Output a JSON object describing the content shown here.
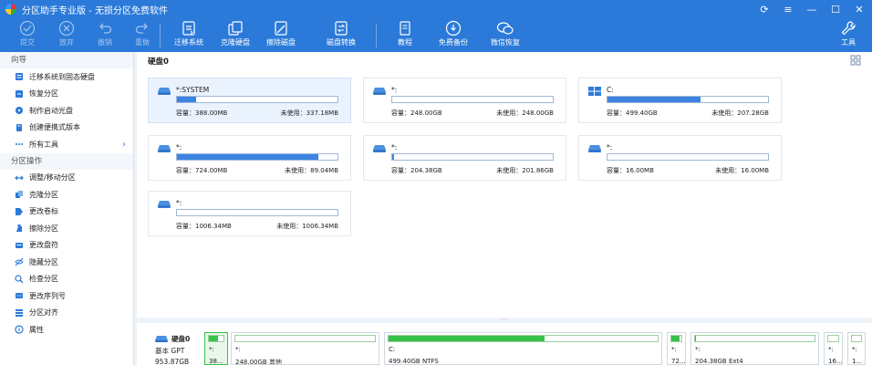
{
  "app": {
    "title": "分区助手专业版 - 无损分区免费软件"
  },
  "toolbar": {
    "commit": "提交",
    "discard": "放弃",
    "undo": "撤销",
    "redo": "重做",
    "migrate": "迁移系统",
    "clone_disk": "克隆硬盘",
    "wipe_disk": "擦除磁盘",
    "disk_convert": "磁盘转换",
    "tutorial": "教程",
    "free_backup": "免费备份",
    "wechat_restore": "微信恢复",
    "tools": "工具"
  },
  "sidebar": {
    "section_wizard": "向导",
    "wizard_items": [
      {
        "label": "迁移系统到固态硬盘",
        "icon": "migrate-icon"
      },
      {
        "label": "恢复分区",
        "icon": "restore-icon"
      },
      {
        "label": "制作启动光盘",
        "icon": "boot-disc-icon"
      },
      {
        "label": "创建便携式版本",
        "icon": "portable-icon"
      },
      {
        "label": "所有工具",
        "icon": "more-icon"
      }
    ],
    "section_ops": "分区操作",
    "ops_items": [
      {
        "label": "调整/移动分区",
        "icon": "resize-icon"
      },
      {
        "label": "克隆分区",
        "icon": "clone-icon"
      },
      {
        "label": "更改卷标",
        "icon": "label-icon"
      },
      {
        "label": "擦除分区",
        "icon": "wipe-icon"
      },
      {
        "label": "更改盘符",
        "icon": "drive-letter-icon"
      },
      {
        "label": "隐藏分区",
        "icon": "hide-icon"
      },
      {
        "label": "检查分区",
        "icon": "check-icon"
      },
      {
        "label": "更改序列号",
        "icon": "serial-icon"
      },
      {
        "label": "分区对齐",
        "icon": "align-icon"
      },
      {
        "label": "属性",
        "icon": "info-icon"
      }
    ]
  },
  "main": {
    "disk_title": "硬盘0",
    "cap_prefix": "容量：",
    "free_prefix": "未使用：",
    "cards": [
      {
        "name": "*:SYSTEM",
        "cap": "388.00MB",
        "free": "337.18MB",
        "fill_pct": 12,
        "os": false,
        "selected": true
      },
      {
        "name": "*:",
        "cap": "248.00GB",
        "free": "248.00GB",
        "fill_pct": 0,
        "os": false,
        "selected": false
      },
      {
        "name": "C:",
        "cap": "499.40GB",
        "free": "207.28GB",
        "fill_pct": 58,
        "os": true,
        "selected": false
      },
      {
        "name": "*:",
        "cap": "724.00MB",
        "free": "89.04MB",
        "fill_pct": 88,
        "os": false,
        "selected": false
      },
      {
        "name": "*:",
        "cap": "204.38GB",
        "free": "201.86GB",
        "fill_pct": 1,
        "os": false,
        "selected": false
      },
      {
        "name": "*:",
        "cap": "16.00MB",
        "free": "16.00MB",
        "fill_pct": 0,
        "os": false,
        "selected": false
      },
      {
        "name": "*:",
        "cap": "1006.34MB",
        "free": "1006.34MB",
        "fill_pct": 0,
        "os": false,
        "selected": false
      }
    ]
  },
  "diskmap": {
    "disk_name": "硬盘0",
    "disk_type": "基本 GPT",
    "disk_size": "953.87GB",
    "segments": [
      {
        "l1": "*:",
        "l2": "38...",
        "fill_pct": 60,
        "selected": true
      },
      {
        "l1": "*:",
        "l2": "248.00GB 其他",
        "fill_pct": 0,
        "selected": false
      },
      {
        "l1": "C:",
        "l2": "499.40GB NTFS",
        "fill_pct": 58,
        "selected": false
      },
      {
        "l1": "*:",
        "l2": "72...",
        "fill_pct": 85,
        "selected": false
      },
      {
        "l1": "*:",
        "l2": "204.38GB Ext4",
        "fill_pct": 1,
        "selected": false
      },
      {
        "l1": "*:",
        "l2": "16...",
        "fill_pct": 0,
        "selected": false
      },
      {
        "l1": "*:",
        "l2": "1...",
        "fill_pct": 0,
        "selected": false
      }
    ]
  },
  "colors": {
    "accent": "#2b7ad9",
    "bar_fill": "#3d84e0",
    "map_fill": "#35c24a"
  }
}
